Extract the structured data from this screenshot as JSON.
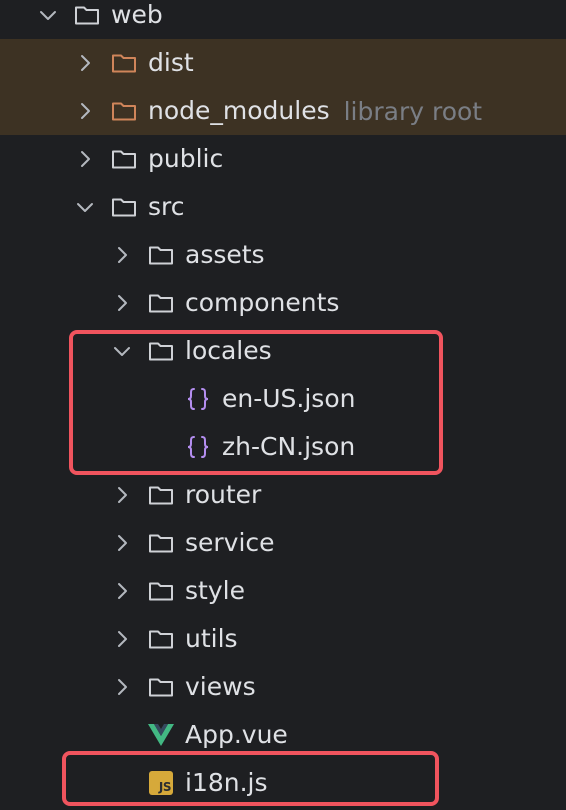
{
  "colors": {
    "background": "#1e1f22",
    "excluded_row_bg": "#3d3223",
    "excluded_folder": "#d0855a",
    "folder": "#cfd1d6",
    "json_icon": "#b48ef0",
    "vue_icon": "#42b883",
    "js_badge": "#d6a93a",
    "highlight_border": "#f0545e",
    "hint_text": "#7a7e85"
  },
  "tree": {
    "root": {
      "label": "web",
      "expanded": true,
      "icon": "folder-icon"
    },
    "dist": {
      "label": "dist",
      "expanded": false,
      "icon": "excluded-folder-icon"
    },
    "node_modules": {
      "label": "node_modules",
      "hint": "library root",
      "expanded": false,
      "icon": "excluded-folder-icon"
    },
    "public": {
      "label": "public",
      "expanded": false,
      "icon": "folder-icon"
    },
    "src": {
      "label": "src",
      "expanded": true,
      "icon": "folder-icon"
    },
    "assets": {
      "label": "assets",
      "expanded": false,
      "icon": "folder-icon"
    },
    "components": {
      "label": "components",
      "expanded": false,
      "icon": "folder-icon"
    },
    "locales": {
      "label": "locales",
      "expanded": true,
      "icon": "folder-icon"
    },
    "en_us": {
      "label": "en-US.json",
      "icon": "json-icon"
    },
    "zh_cn": {
      "label": "zh-CN.json",
      "icon": "json-icon"
    },
    "router": {
      "label": "router",
      "expanded": false,
      "icon": "folder-icon"
    },
    "service": {
      "label": "service",
      "expanded": false,
      "icon": "folder-icon"
    },
    "style": {
      "label": "style",
      "expanded": false,
      "icon": "folder-icon"
    },
    "utils": {
      "label": "utils",
      "expanded": false,
      "icon": "folder-icon"
    },
    "views": {
      "label": "views",
      "expanded": false,
      "icon": "folder-icon"
    },
    "app_vue": {
      "label": "App.vue",
      "icon": "vue-icon"
    },
    "i18n_js": {
      "label": "i18n.js",
      "icon": "js-file-icon",
      "badge": "JS"
    }
  }
}
